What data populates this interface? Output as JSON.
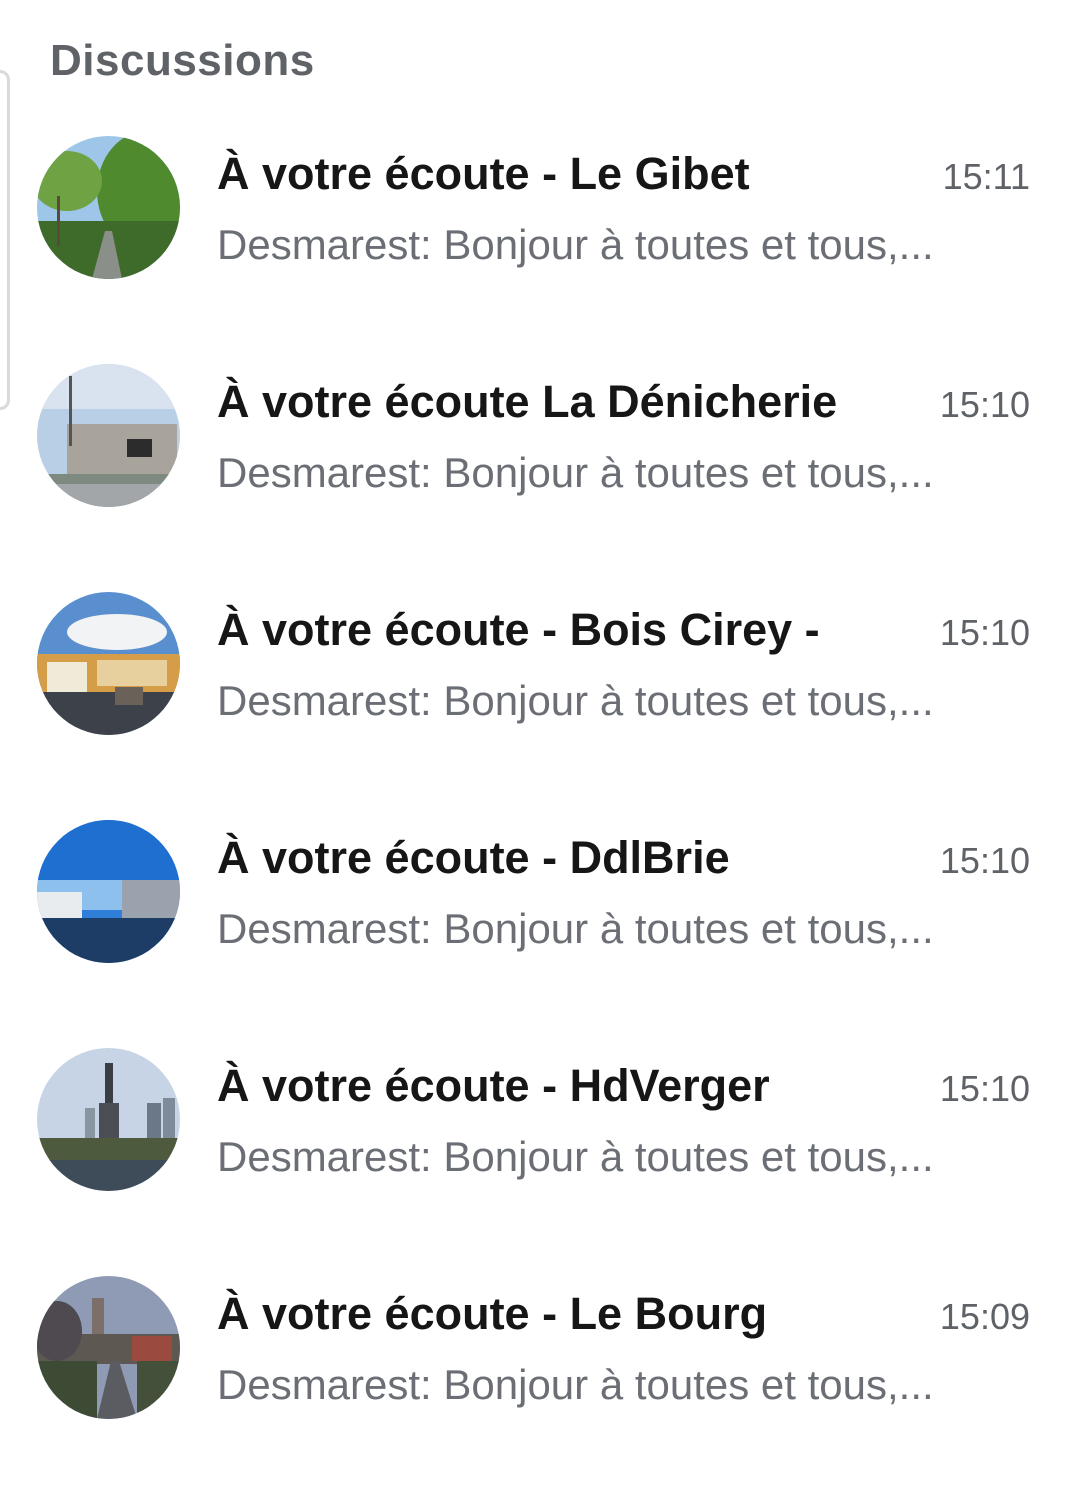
{
  "header": {
    "title": "Discussions"
  },
  "chats": [
    {
      "name": "À votre écoute - Le Gibet",
      "time": "15:11",
      "preview": "Desmarest: Bonjour à toutes et tous,...",
      "avatar_icon": "photo-trees-road"
    },
    {
      "name": "À votre écoute La Dénicherie",
      "time": "15:10",
      "preview": "Desmarest: Bonjour à toutes et tous,...",
      "avatar_icon": "photo-building"
    },
    {
      "name": "À votre écoute - Bois Cirey -",
      "time": "15:10",
      "preview": "Desmarest: Bonjour à toutes et tous,...",
      "avatar_icon": "photo-street-houses"
    },
    {
      "name": "À votre écoute - DdlBrie",
      "time": "15:10",
      "preview": "Desmarest: Bonjour à toutes et tous,...",
      "avatar_icon": "photo-blue-sky-street"
    },
    {
      "name": "À votre écoute - HdVerger",
      "time": "15:10",
      "preview": "Desmarest: Bonjour à toutes et tous,...",
      "avatar_icon": "photo-statue-towers"
    },
    {
      "name": "À votre écoute - Le Bourg",
      "time": "15:09",
      "preview": "Desmarest: Bonjour à toutes et tous,...",
      "avatar_icon": "photo-village-road"
    }
  ]
}
